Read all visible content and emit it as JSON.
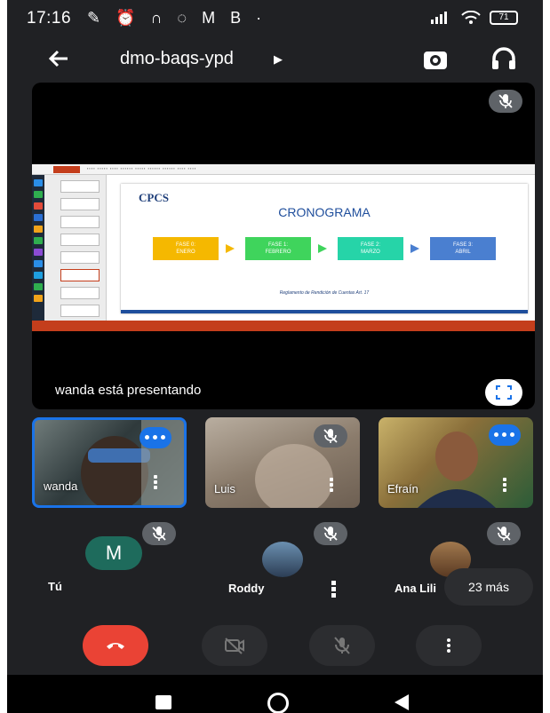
{
  "status_bar": {
    "time": "17:16",
    "notification_icons": "✎ ⏰ ∩ ◌ M B ·",
    "battery": "71"
  },
  "app_bar": {
    "meeting_code": "dmo-baqs-ypd"
  },
  "presentation": {
    "presenter_label": "wanda está presentando",
    "slide": {
      "logo_text": "CPCS",
      "title": "CRONOGRAMA",
      "phases": [
        {
          "label": "FASE 0:\nENERO",
          "color": "#f5b800"
        },
        {
          "label": "FASE 1:\nFEBRERO",
          "color": "#3fd45c"
        },
        {
          "label": "FASE 2:\nMARZO",
          "color": "#26d4a8"
        },
        {
          "label": "FASE 3:\nABRIL",
          "color": "#4a7fd0"
        }
      ],
      "footer": "Reglamento de Rendición de Cuentas Art. 17"
    }
  },
  "participants": [
    {
      "name": "wanda",
      "speaking": true,
      "active": true
    },
    {
      "name": "Luis",
      "muted": true
    },
    {
      "name": "Efraín",
      "speaking": true
    }
  ],
  "audio_participants": [
    {
      "name": "Tú",
      "avatar_letter": "M",
      "avatar_color": "#1e6b5c"
    },
    {
      "name": "Roddy"
    },
    {
      "name": "Ana Lili"
    }
  ],
  "more_participants": "23 más",
  "controls": [
    "end-call",
    "camera-off",
    "mic-off",
    "more-options"
  ],
  "colors": {
    "background": "#202124",
    "accent_blue": "#1a73e8",
    "end_call_red": "#ea4335"
  }
}
